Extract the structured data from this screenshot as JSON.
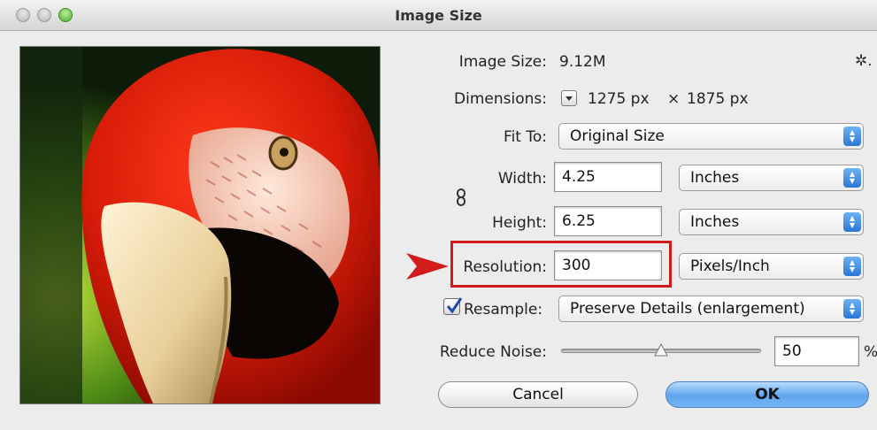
{
  "window": {
    "title": "Image Size"
  },
  "info": {
    "image_size_label": "Image Size:",
    "image_size_value": "9.12M",
    "dimensions_label": "Dimensions:",
    "dimensions_width": "1275 px",
    "dimensions_times": "×",
    "dimensions_height": "1875 px"
  },
  "fit_to": {
    "label": "Fit To:",
    "value": "Original Size"
  },
  "width": {
    "label": "Width:",
    "value": "4.25",
    "unit": "Inches"
  },
  "height": {
    "label": "Height:",
    "value": "6.25",
    "unit": "Inches"
  },
  "resolution": {
    "label": "Resolution:",
    "value": "300",
    "unit": "Pixels/Inch"
  },
  "resample": {
    "label": "Resample:",
    "checked": true,
    "value": "Preserve Details (enlargement)"
  },
  "reduce_noise": {
    "label": "Reduce Noise:",
    "value": "50",
    "unit": "%",
    "level": 0.5
  },
  "buttons": {
    "cancel": "Cancel",
    "ok": "OK"
  },
  "icons": {
    "gear": "gear-icon",
    "link": "link-chain-icon",
    "dimensions_menu": "dropdown-menu-icon",
    "annotation_arrow": "red-arrow-icon"
  },
  "colors": {
    "highlight": "#d21c1c",
    "accent": "#2a76d6",
    "ok_button": "#5fa3ee"
  }
}
